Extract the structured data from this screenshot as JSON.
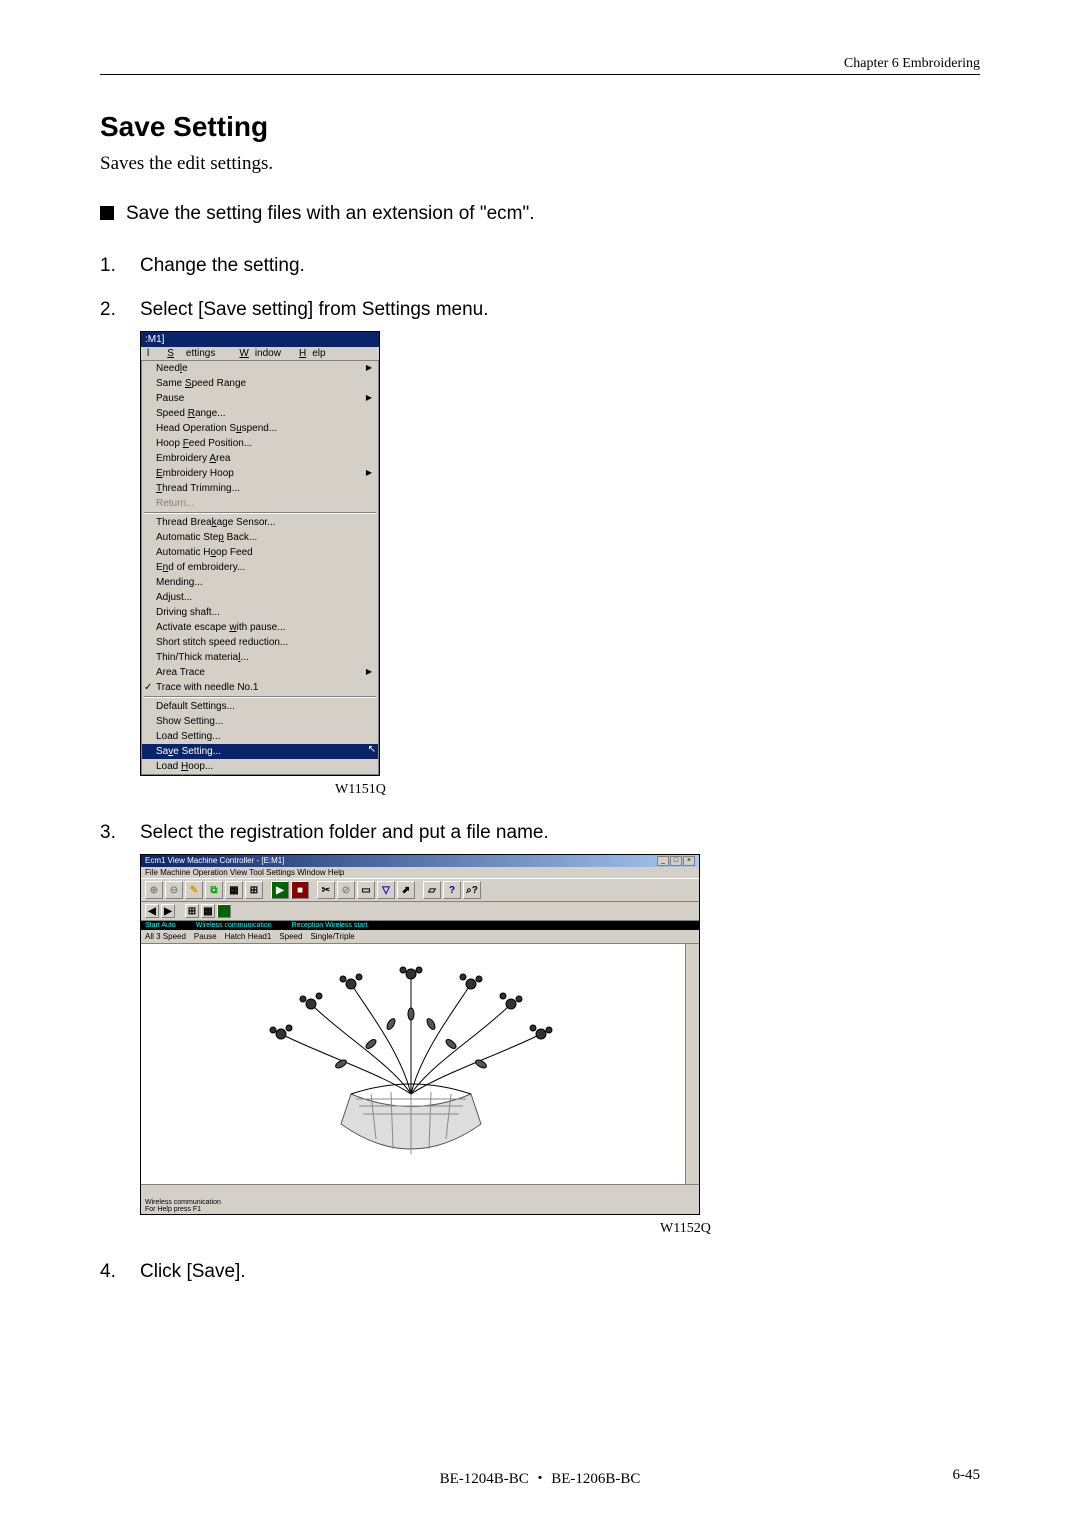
{
  "header": {
    "chapter": "Chapter 6    Embroidering"
  },
  "section": {
    "title": "Save Setting",
    "description": "Saves the edit settings.",
    "note": "Save the setting files with an extension of \"ecm\"."
  },
  "steps": {
    "s1": {
      "num": "1.",
      "text": "Change the setting."
    },
    "s2": {
      "num": "2.",
      "text": "Select [Save setting] from Settings menu."
    },
    "s3": {
      "num": "3.",
      "text": "Select the registration folder and put a file name."
    },
    "s4": {
      "num": "4.",
      "text": "Click [Save]."
    }
  },
  "figure1": {
    "titlebar": ":M1]",
    "menubar": {
      "settings": "Settings",
      "window": "Window",
      "help": "Help"
    },
    "items": {
      "needle": "Needle",
      "same_speed": "Same Speed Range",
      "pause": "Pause",
      "speed_range": "Speed Range...",
      "head_op": "Head Operation Suspend...",
      "hoop_feed": "Hoop Feed Position...",
      "emb_area": "Embroidery Area",
      "emb_hoop": "Embroidery Hoop",
      "thread_trim": "Thread Trimming...",
      "return": "Return...",
      "thread_break": "Thread Breakage Sensor...",
      "auto_step": "Automatic Step Back...",
      "auto_hoop": "Automatic Hoop Feed",
      "end_emb": "End of embroidery...",
      "mending": "Mending...",
      "adjust": "Adjust...",
      "driving": "Driving shaft...",
      "activate": "Activate escape with pause...",
      "short_stitch": "Short stitch speed reduction...",
      "thin_thick": "Thin/Thick material...",
      "area_trace": "Area Trace",
      "trace_needle": "Trace with needle No.1",
      "default_set": "Default Settings...",
      "show_set": "Show Setting...",
      "load_set": "Load Setting...",
      "save_set": "Save Setting...",
      "load_hoop": "Load Hoop..."
    },
    "arrow": "▶",
    "label": "W1151Q"
  },
  "figure2": {
    "title_text": "Ecm1 View  Machine  Controller - [E:M1]",
    "menubar_text": "File  Machine  Operation  View  Tool  Settings  Window  Help",
    "tabs": {
      "pause": "Pause",
      "hatch": "Hatch  Head1",
      "speed": "Speed",
      "single": "Single/Triple"
    },
    "status": {
      "left": "Start Auto",
      "mid": "Wireless communication",
      "right": "Reception  Wireless  start"
    },
    "bottom": {
      "left": "Wireless communication\nFor Help   press F1",
      "right": ""
    },
    "label": "W1152Q"
  },
  "footer": {
    "center": "BE-1204B-BC ・ BE-1206B-BC",
    "right": "6-45"
  }
}
